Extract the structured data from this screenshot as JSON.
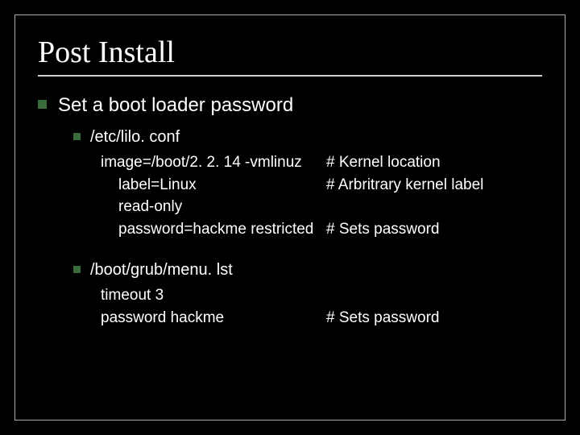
{
  "title": "Post Install",
  "main_bullet": "Set a boot loader password",
  "sections": [
    {
      "heading": "/etc/lilo. conf",
      "lines": [
        {
          "left": "image=/boot/2. 2. 14 -vmlinuz",
          "right": "# Kernel location",
          "indent": "indent1"
        },
        {
          "left": "label=Linux",
          "right": "# Arbritrary kernel label",
          "indent": "indent2"
        },
        {
          "left": "read-only",
          "right": "",
          "indent": "indent2"
        },
        {
          "left": "password=hackme restricted",
          "right": "# Sets password",
          "indent": "indent2"
        }
      ]
    },
    {
      "heading": "/boot/grub/menu. lst",
      "lines": [
        {
          "left": "timeout 3",
          "right": "",
          "indent": "indent1"
        },
        {
          "left": "password hackme",
          "right": "# Sets password",
          "indent": "indent1"
        }
      ]
    }
  ]
}
